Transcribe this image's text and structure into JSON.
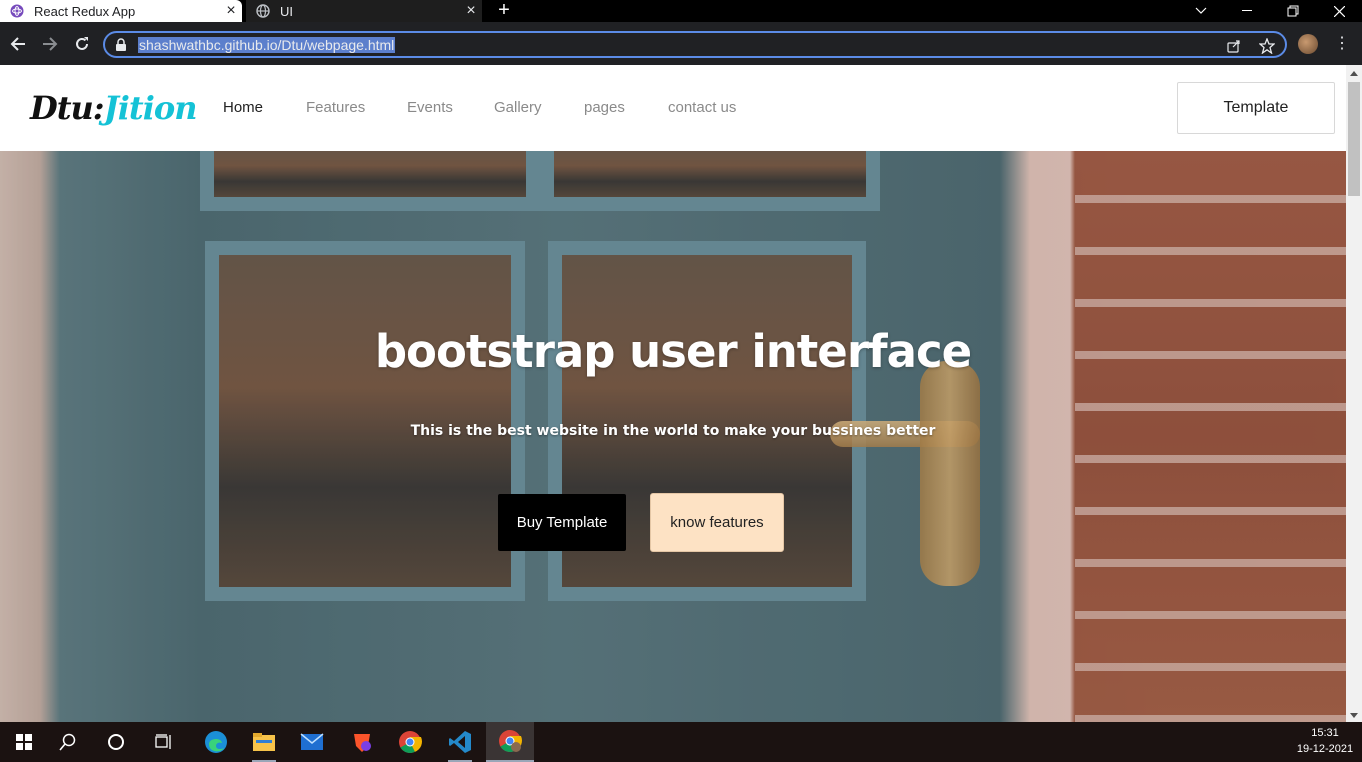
{
  "browser": {
    "tabs": [
      {
        "title": "React Redux App",
        "active": true,
        "icon": "react-redux-favicon-icon"
      },
      {
        "title": "UI",
        "active": false,
        "icon": "globe-icon"
      }
    ],
    "new_tab": "+",
    "address": "shashwathbc.github.io/Dtu/webpage.html"
  },
  "site": {
    "brand_part1": "Dtu:",
    "brand_part2": "Jition",
    "nav": [
      "Home",
      "Features",
      "Events",
      "Gallery",
      "pages",
      "contact us"
    ],
    "nav_button": "Template",
    "hero": {
      "title": "bootstrap user interface",
      "subtitle": "This is the best website in the world to make your bussines better",
      "primary_button": "Buy Template",
      "secondary_button": "know features"
    }
  },
  "taskbar": {
    "time": "15:31",
    "date": "19-12-2021"
  },
  "colors": {
    "brand_accent": "#15c2d6",
    "omnibox_border": "#5b8be6",
    "secondary_button_bg": "#fde2c4"
  }
}
